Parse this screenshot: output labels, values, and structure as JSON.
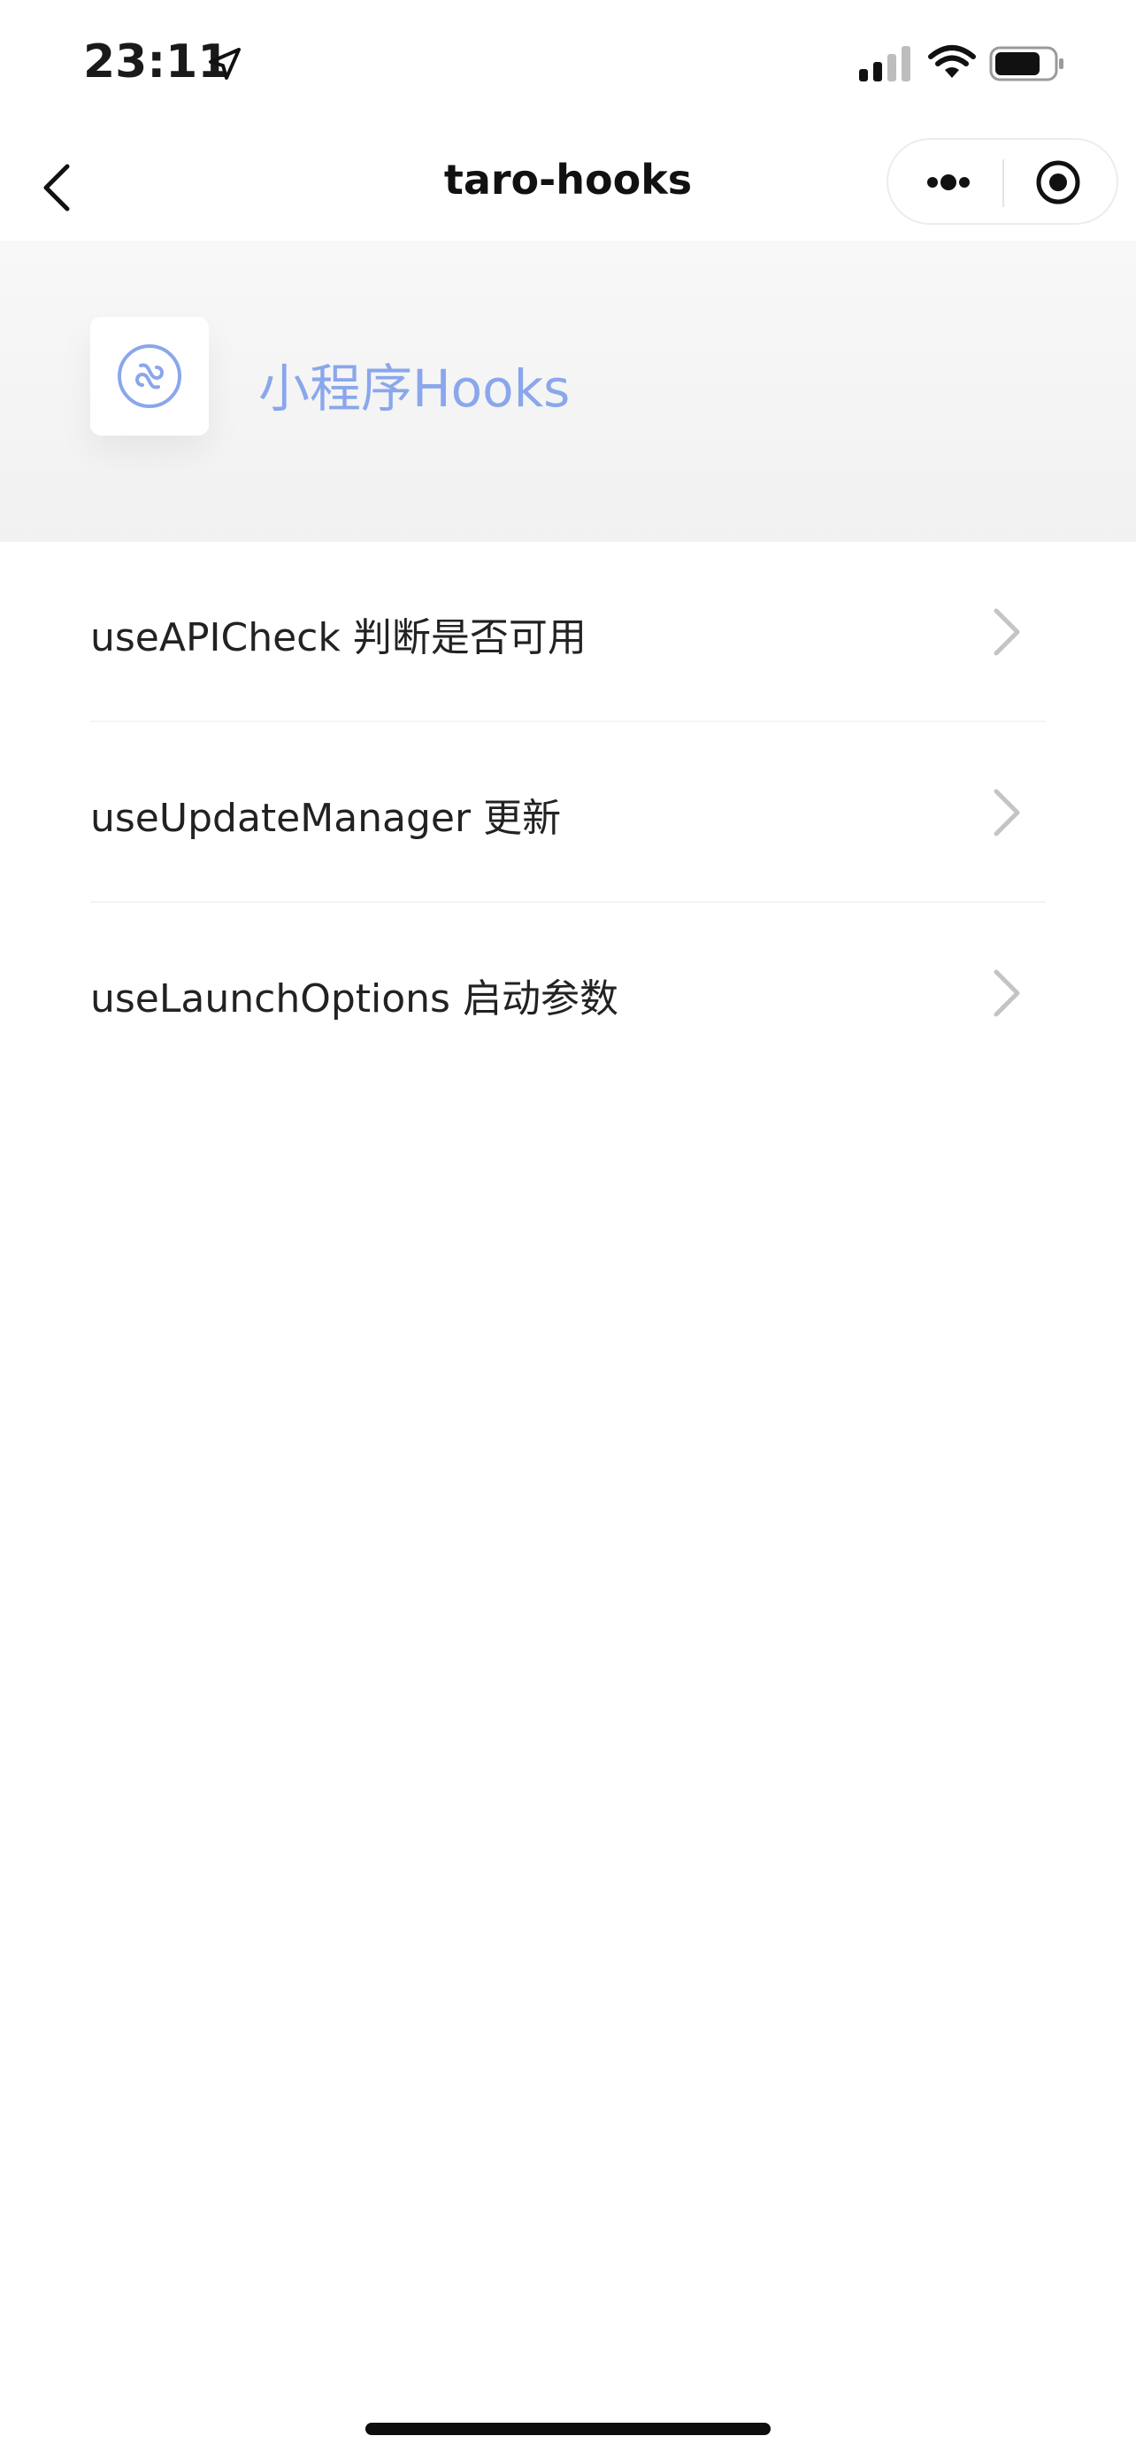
{
  "status_bar": {
    "time": "23:11",
    "icons": [
      "location-arrow-icon",
      "cellular-signal-icon",
      "wifi-icon",
      "battery-icon"
    ]
  },
  "nav_bar": {
    "title": "taro-hooks",
    "back_icon": "chevron-left-icon",
    "capsule_icons": [
      "more-dots-icon",
      "close-target-icon"
    ]
  },
  "header": {
    "icon": "mini-program-link-icon",
    "title": "小程序Hooks",
    "accent_color": "#8aa7ec"
  },
  "menu": {
    "items": [
      {
        "label": "useAPICheck 判断是否可用"
      },
      {
        "label": "useUpdateManager 更新"
      },
      {
        "label": "useLaunchOptions 启动参数"
      }
    ]
  }
}
